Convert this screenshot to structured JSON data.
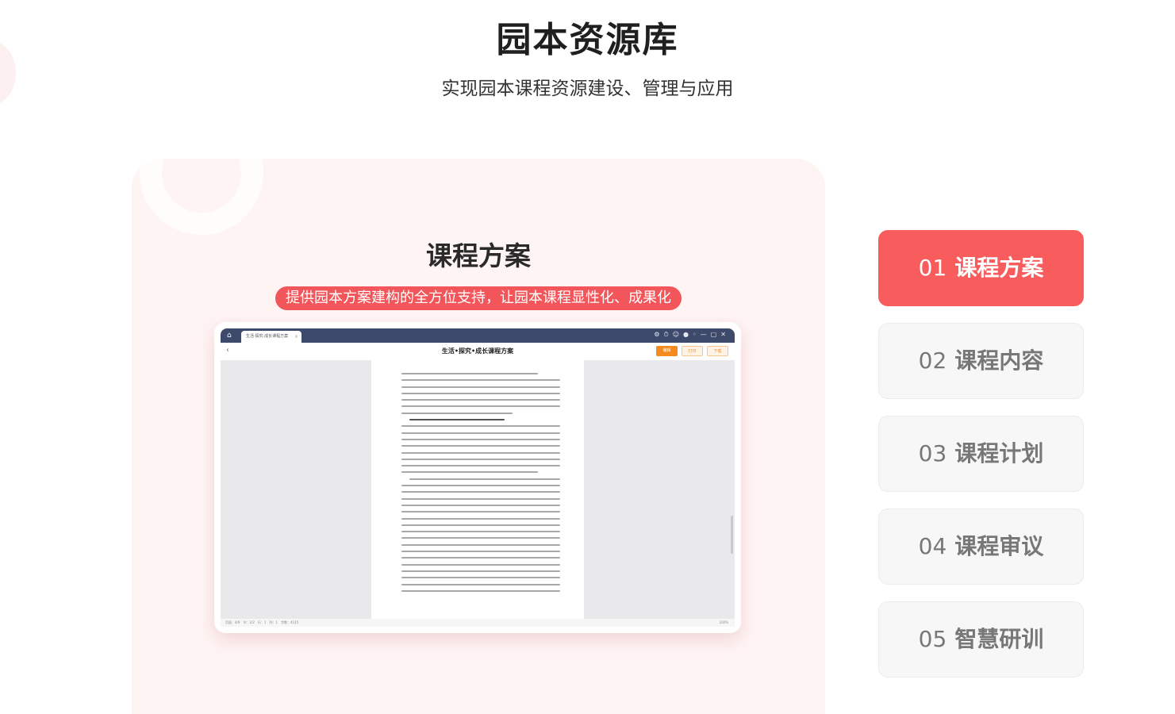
{
  "hero": {
    "title": "园本资源库",
    "subtitle": "实现园本课程资源建设、管理与应用"
  },
  "panel": {
    "title": "课程方案",
    "pill": "提供园本方案建构的全方位支持，让园本课程显性化、成果化"
  },
  "app": {
    "tab_label": "生活·探究·成长课程方案",
    "tab_close": "×",
    "doc_title": "生活•探究•成长课程方案",
    "back": "‹",
    "edit": "编辑",
    "print": "打印",
    "download": "下载",
    "status_left": "页面：4/9　节：2/2　行：1　列：1　字数：4145",
    "status_right": "100%"
  },
  "tabs": [
    {
      "num": "01",
      "label": "课程方案",
      "active": true
    },
    {
      "num": "02",
      "label": "课程内容",
      "active": false
    },
    {
      "num": "03",
      "label": "课程计划",
      "active": false
    },
    {
      "num": "04",
      "label": "课程审议",
      "active": false
    },
    {
      "num": "05",
      "label": "智慧研训",
      "active": false
    }
  ],
  "colors": {
    "accent": "#f95c5c",
    "panel_bg": "#fff4f4",
    "window_bar": "#3d4a6b",
    "button_orange": "#f58a1f"
  },
  "icons": [
    "home-icon",
    "window-controls-icon",
    "back-arrow-icon"
  ]
}
